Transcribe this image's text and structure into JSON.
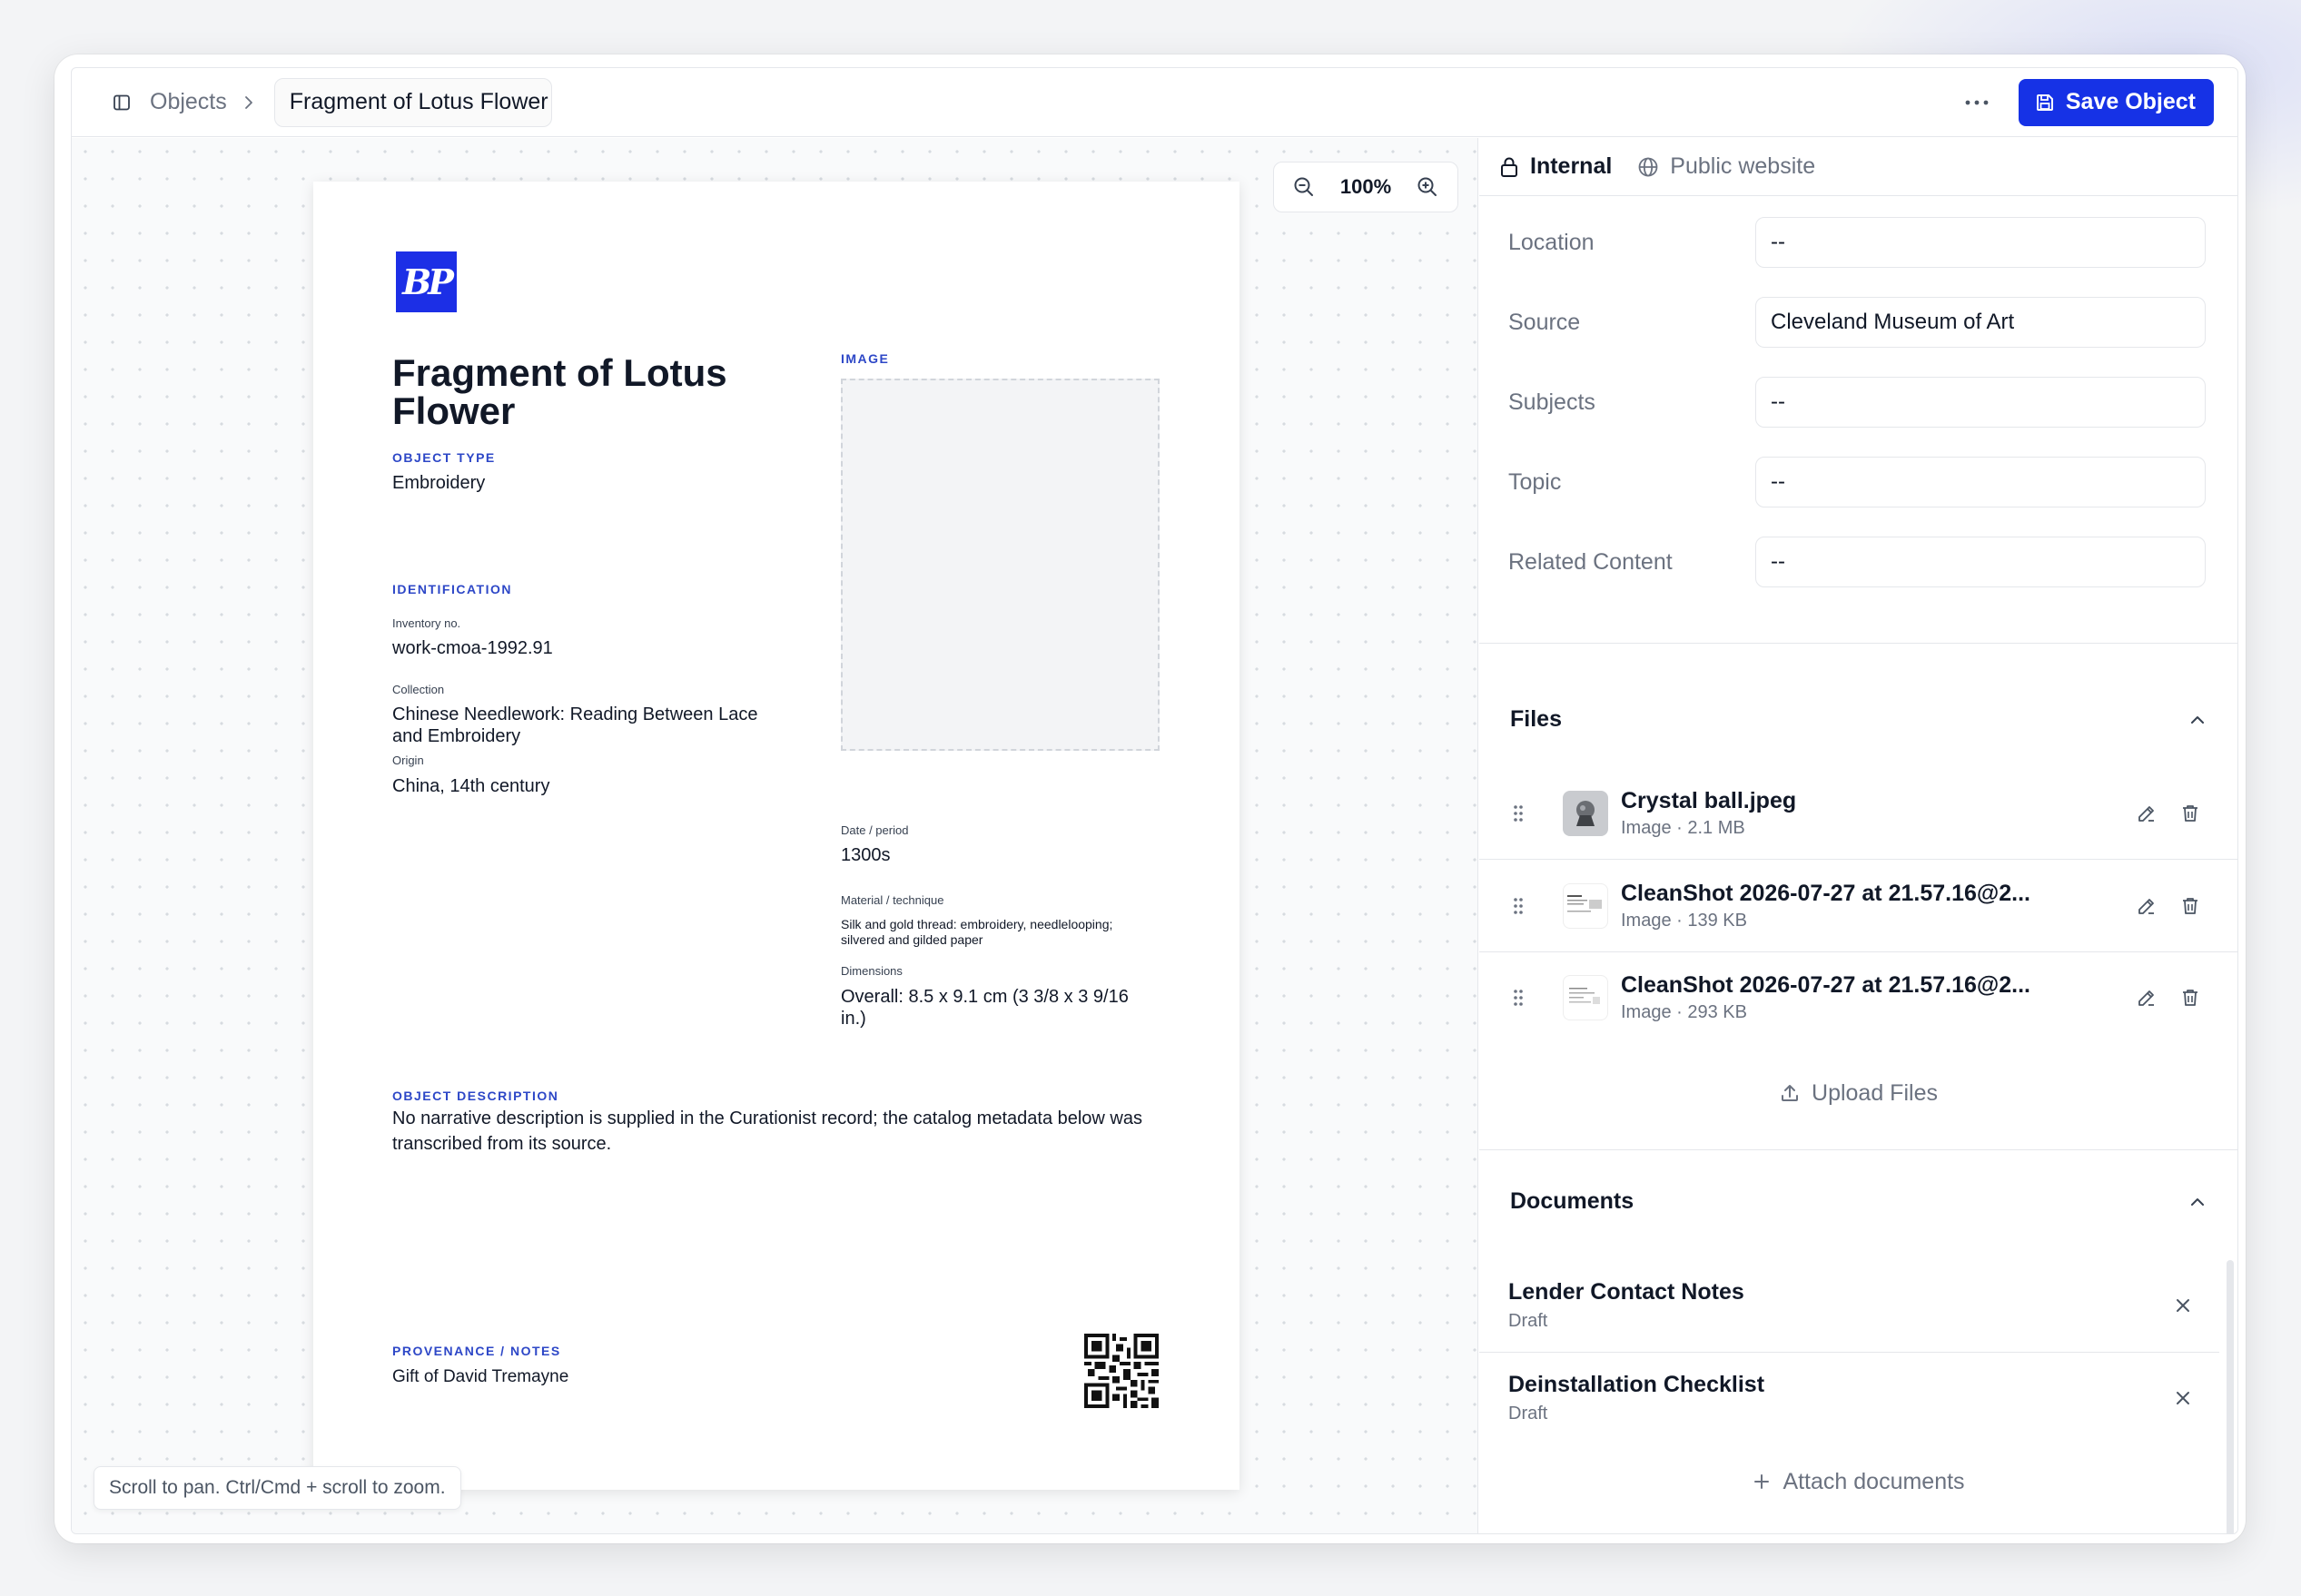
{
  "breadcrumb": {
    "root": "Objects",
    "current": "Fragment of Lotus Flower"
  },
  "toolbar": {
    "save_label": "Save Object"
  },
  "canvas": {
    "zoom_level": "100%",
    "hint": "Scroll to pan. Ctrl/Cmd + scroll to zoom."
  },
  "preview": {
    "title": "Fragment of Lotus Flower",
    "object_type_label": "OBJECT TYPE",
    "object_type": "Embroidery",
    "image_label": "IMAGE",
    "identification_label": "IDENTIFICATION",
    "inventory_label": "Inventory no.",
    "inventory": "work-cmoa-1992.91",
    "collection_label": "Collection",
    "collection": "Chinese Needlework: Reading Between Lace and Embroidery",
    "origin_label": "Origin",
    "origin": "China, 14th century",
    "date_label": "Date / period",
    "date": "1300s",
    "material_label": "Material / technique",
    "material": "Silk and gold thread: embroidery, needlelooping; silvered and gilded paper",
    "dimensions_label": "Dimensions",
    "dimensions": "Overall: 8.5 x 9.1 cm (3 3/8 x 3 9/16 in.)",
    "description_label": "OBJECT DESCRIPTION",
    "description": "No narrative description is supplied in the Curationist record; the catalog metadata below was transcribed from its source.",
    "provenance_label": "PROVENANCE / NOTES",
    "provenance": "Gift of David Tremayne"
  },
  "visibility_tabs": [
    {
      "label": "Internal",
      "icon": "lock-icon"
    },
    {
      "label": "Public website",
      "icon": "globe-icon"
    }
  ],
  "fields": [
    {
      "label": "Location",
      "value": "--"
    },
    {
      "label": "Source",
      "value": "Cleveland Museum of Art"
    },
    {
      "label": "Subjects",
      "value": "--"
    },
    {
      "label": "Topic",
      "value": "--"
    },
    {
      "label": "Related Content",
      "value": "--"
    }
  ],
  "files": {
    "title": "Files",
    "items": [
      {
        "name": "Crystal ball.jpeg",
        "meta": "Image · 2.1 MB"
      },
      {
        "name": "CleanShot 2026-07-27 at 21.57.16@2...",
        "meta": "Image · 139 KB"
      },
      {
        "name": "CleanShot 2026-07-27 at 21.57.16@2...",
        "meta": "Image · 293 KB"
      }
    ],
    "upload_label": "Upload Files"
  },
  "documents": {
    "title": "Documents",
    "items": [
      {
        "name": "Lender Contact Notes",
        "status": "Draft"
      },
      {
        "name": "Deinstallation Checklist",
        "status": "Draft"
      }
    ],
    "attach_label": "Attach documents"
  },
  "colors": {
    "accent": "#1632e6",
    "section_label": "#2d47c7",
    "logo_bg": "#1c2fe6"
  }
}
